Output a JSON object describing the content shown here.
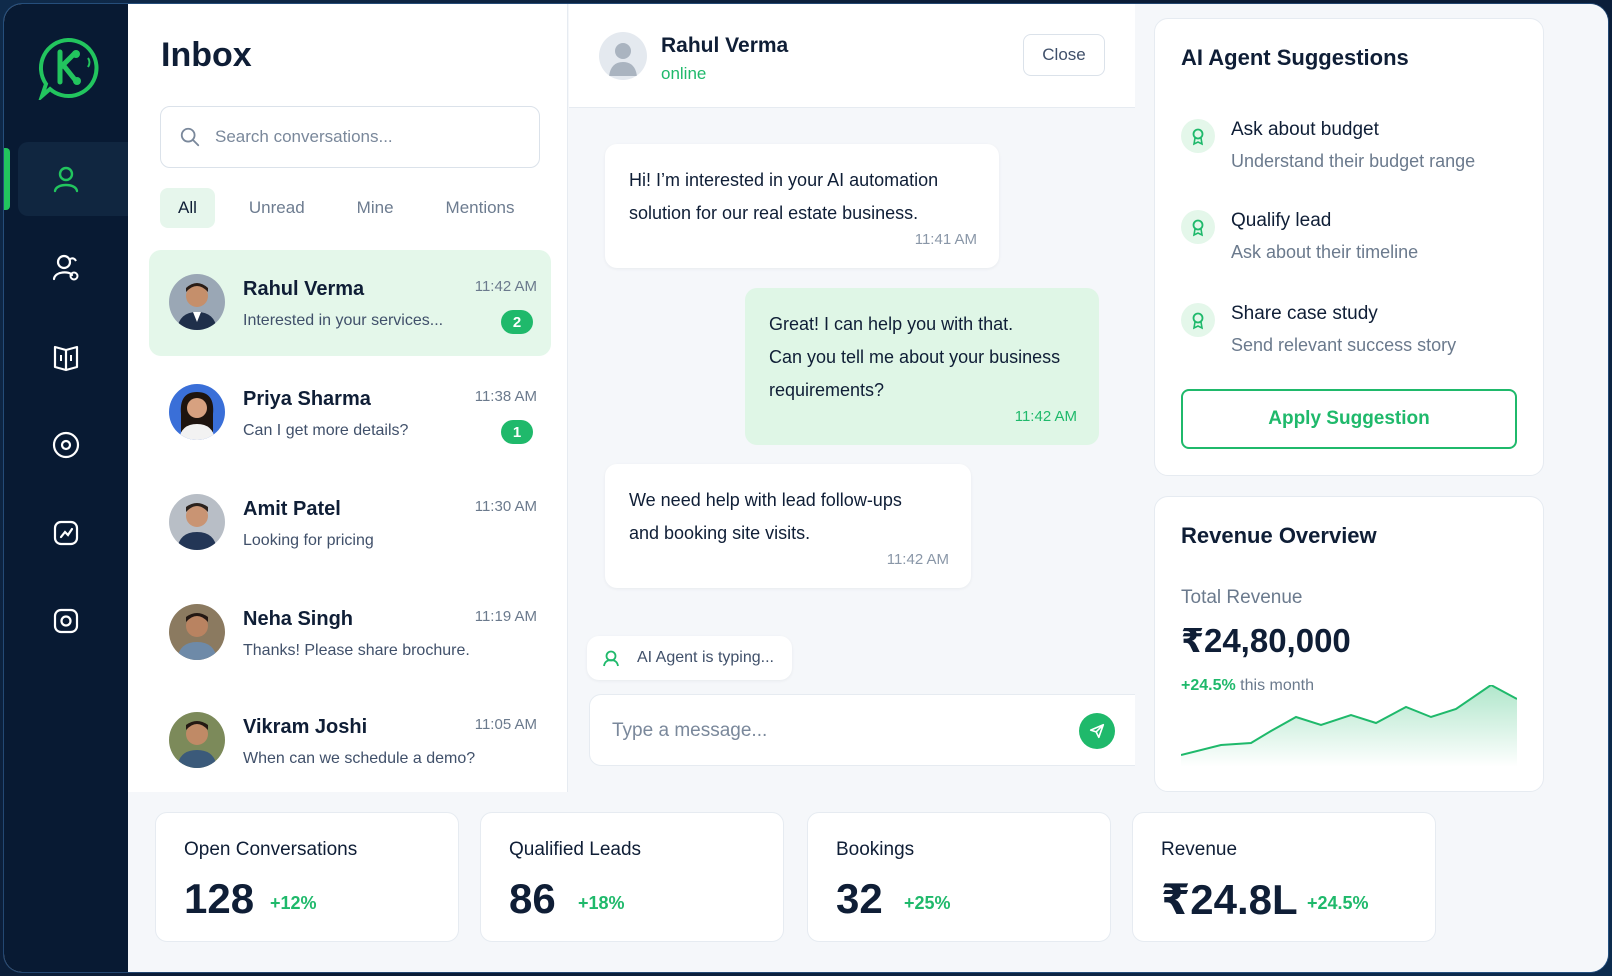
{
  "colors": {
    "accent": "#1fb96b",
    "sidebar": "#081a33"
  },
  "sidebar": {
    "logo": "logo-icon",
    "items": [
      {
        "icon": "user-icon",
        "active": true
      },
      {
        "icon": "users-icon",
        "active": false
      },
      {
        "icon": "book-icon",
        "active": false
      },
      {
        "icon": "target-icon",
        "active": false
      },
      {
        "icon": "analytics-icon",
        "active": false
      },
      {
        "icon": "settings-icon",
        "active": false
      }
    ]
  },
  "inbox": {
    "title": "Inbox",
    "search_placeholder": "Search conversations...",
    "filters": [
      "All",
      "Unread",
      "Mine",
      "Mentions"
    ],
    "conversations": [
      {
        "name": "Rahul Verma",
        "time": "11:42 AM",
        "preview": "Interested in your services...",
        "badge": "2"
      },
      {
        "name": "Priya Sharma",
        "time": "11:38 AM",
        "preview": "Can I get more details?",
        "badge": "1"
      },
      {
        "name": "Amit Patel",
        "time": "11:30 AM",
        "preview": "Looking for pricing",
        "badge": ""
      },
      {
        "name": "Neha Singh",
        "time": "11:19 AM",
        "preview": "Thanks! Please share brochure.",
        "badge": ""
      },
      {
        "name": "Vikram Joshi",
        "time": "11:05 AM",
        "preview": "When can we schedule a demo?",
        "badge": ""
      }
    ]
  },
  "chat": {
    "name": "Rahul Verma",
    "status": "online",
    "close_label": "Close",
    "messages": [
      {
        "direction": "in",
        "lines": [
          "Hi! I’m interested in your AI automation",
          "solution for our real estate business."
        ],
        "time": "11:41 AM"
      },
      {
        "direction": "out",
        "lines": [
          "Great! I can help you with that.",
          "Can you tell me about your business",
          "requirements?"
        ],
        "time": "11:42 AM"
      },
      {
        "direction": "in",
        "lines": [
          "We need help with lead follow-ups",
          "and booking site visits."
        ],
        "time": "11:42 AM"
      }
    ],
    "typing": "AI Agent is typing...",
    "composer_placeholder": "Type a message..."
  },
  "suggestions": {
    "title": "AI Agent Suggestions",
    "items": [
      {
        "title": "Ask about budget",
        "subtitle": "Understand their budget range"
      },
      {
        "title": "Qualify lead",
        "subtitle": "Ask about their timeline"
      },
      {
        "title": "Share case study",
        "subtitle": "Send relevant success story"
      }
    ],
    "apply_label": "Apply Suggestion"
  },
  "revenue": {
    "title": "Revenue Overview",
    "label": "Total Revenue",
    "value": "₹24,80,000",
    "change": "+24.5%",
    "change_suffix": "this month"
  },
  "stats": [
    {
      "label": "Open Conversations",
      "value": "128",
      "change": "+12%"
    },
    {
      "label": "Qualified Leads",
      "value": "86",
      "change": "+18%"
    },
    {
      "label": "Bookings",
      "value": "32",
      "change": "+25%"
    },
    {
      "label": "Revenue",
      "value": "₹24.8L",
      "change": "+24.5%"
    }
  ]
}
